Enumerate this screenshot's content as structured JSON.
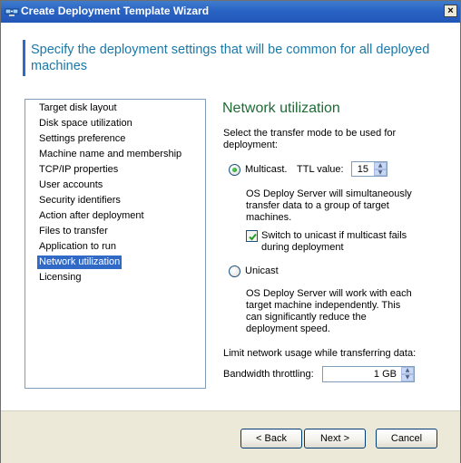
{
  "window": {
    "title": "Create Deployment Template Wizard",
    "close_glyph": "×"
  },
  "header": {
    "text": "Specify the deployment settings that will be common for all deployed machines"
  },
  "steps": [
    {
      "label": "Target disk layout",
      "selected": false
    },
    {
      "label": "Disk space utilization",
      "selected": false
    },
    {
      "label": "Settings preference",
      "selected": false
    },
    {
      "label": "Machine name and membership",
      "selected": false
    },
    {
      "label": "TCP/IP properties",
      "selected": false
    },
    {
      "label": "User accounts",
      "selected": false
    },
    {
      "label": "Security identifiers",
      "selected": false
    },
    {
      "label": "Action after deployment",
      "selected": false
    },
    {
      "label": "Files to transfer",
      "selected": false
    },
    {
      "label": "Application to run",
      "selected": false
    },
    {
      "label": "Network utilization",
      "selected": true
    },
    {
      "label": "Licensing",
      "selected": false
    }
  ],
  "panel": {
    "title": "Network utilization",
    "instruction_line1": "Select the transfer mode to be used for",
    "instruction_line2": "deployment:",
    "multicast": {
      "label": "Multicast.",
      "selected": true,
      "ttl_label": "TTL value:",
      "ttl_value": "15",
      "desc_line1": "OS Deploy Server will simultaneously",
      "desc_line2": "transfer data to a group of target",
      "desc_line3": "machines.",
      "fallback_line1": "Switch to unicast if multicast fails",
      "fallback_line2": "during deployment",
      "fallback_checked": true
    },
    "unicast": {
      "label": "Unicast",
      "selected": false,
      "desc_line1": "OS Deploy Server will work with each",
      "desc_line2": "target machine independently. This",
      "desc_line3": "can significantly reduce the",
      "desc_line4": "deployment speed."
    },
    "limit_label": "Limit network usage while transferring data:",
    "bandwidth_label": "Bandwidth throttling:",
    "bandwidth_value": "1 GB"
  },
  "footer": {
    "back_label": "< Back",
    "next_label": "Next >",
    "cancel_label": "Cancel"
  },
  "colors": {
    "titlebar": "#2a63c4",
    "header_text": "#1a78a8",
    "panel_title": "#1e6b35",
    "selection": "#3169c6"
  }
}
